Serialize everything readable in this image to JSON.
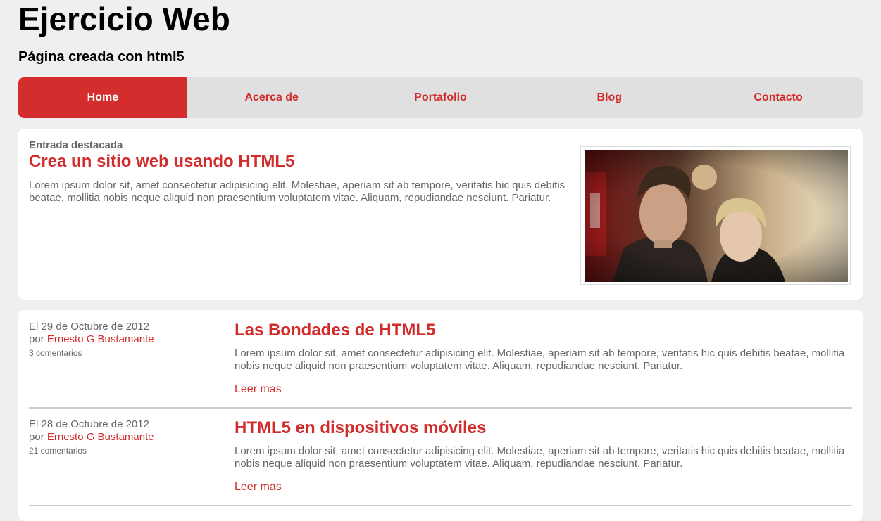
{
  "header": {
    "title": "Ejercicio Web",
    "subtitle": "Página creada con html5"
  },
  "nav": {
    "items": [
      {
        "label": "Home",
        "active": true
      },
      {
        "label": "Acerca de"
      },
      {
        "label": "Portafolio"
      },
      {
        "label": "Blog"
      },
      {
        "label": "Contacto"
      }
    ]
  },
  "featured": {
    "kicker": "Entrada destacada",
    "title": "Crea un sitio web usando HTML5",
    "body": "Lorem ipsum dolor sit, amet consectetur adipisicing elit. Molestiae, aperiam sit ab tempore, veritatis hic quis debitis beatae, mollitia nobis neque aliquid non praesentium voluptatem vitae. Aliquam, repudiandae nesciunt. Pariatur.",
    "image": "photo-of-young-man-and-woman"
  },
  "posts": [
    {
      "date": "El 29 de Octubre de 2012",
      "by": "por ",
      "author": "Ernesto G Bustamante",
      "comments": "3 comentarios",
      "title": "Las Bondades de HTML5",
      "body": "Lorem ipsum dolor sit, amet consectetur adipisicing elit. Molestiae, aperiam sit ab tempore, veritatis hic quis debitis beatae, mollitia nobis neque aliquid non praesentium voluptatem vitae. Aliquam, repudiandae nesciunt. Pariatur.",
      "more": "Leer mas"
    },
    {
      "date": "El 28 de Octubre de 2012",
      "by": "por ",
      "author": "Ernesto G Bustamante",
      "comments": "21 comentarios",
      "title": "HTML5 en dispositivos móviles",
      "body": "Lorem ipsum dolor sit, amet consectetur adipisicing elit. Molestiae, aperiam sit ab tempore, veritatis hic quis debitis beatae, mollitia nobis neque aliquid non praesentium voluptatem vitae. Aliquam, repudiandae nesciunt. Pariatur.",
      "more": "Leer mas"
    }
  ],
  "colors": {
    "accent": "#d42d2d",
    "background": "#efefef",
    "nav_bg": "#e0e0e0"
  }
}
